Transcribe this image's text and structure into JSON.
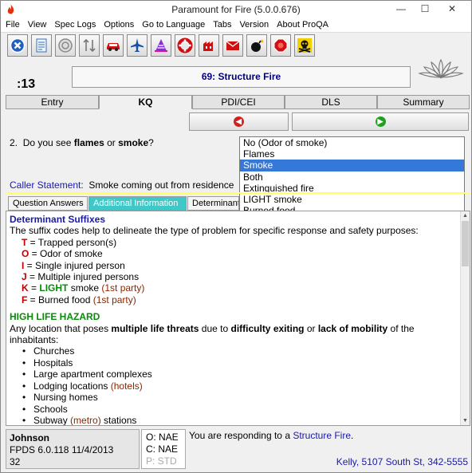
{
  "window": {
    "title": "Paramount for Fire (5.0.0.676)",
    "minimize": "—",
    "maximize": "☐",
    "close": "✕"
  },
  "menu": [
    "File",
    "View",
    "Spec Logs",
    "Options",
    "Go to Language",
    "Tabs",
    "Version",
    "About ProQA"
  ],
  "toolbar": [
    {
      "icon": "close-case-icon",
      "color": "#2060c0"
    },
    {
      "icon": "document-icon",
      "color": "#3a6fb0"
    },
    {
      "icon": "stop-target-icon",
      "color": "#888888"
    },
    {
      "icon": "sort-arrows-icon",
      "color": "#777777"
    },
    {
      "icon": "car-icon",
      "color": "#d01010"
    },
    {
      "icon": "airplane-icon",
      "color": "#1a4fa8"
    },
    {
      "icon": "hazmat-cone-icon",
      "color": "#8a2be2"
    },
    {
      "icon": "lifebuoy-icon",
      "color": "#d01010"
    },
    {
      "icon": "building-icon",
      "color": "#d01010"
    },
    {
      "icon": "envelope-icon",
      "color": "#d01010"
    },
    {
      "icon": "bomb-icon",
      "color": "#111111"
    },
    {
      "icon": "stop-sign-icon",
      "color": "#d01010"
    },
    {
      "icon": "skull-icon",
      "color": "#c8a000"
    }
  ],
  "header": {
    "timer": ":13",
    "protocol": "69:  Structure Fire"
  },
  "main_tabs": [
    "Entry",
    "KQ",
    "PDI/CEI",
    "DLS",
    "Summary"
  ],
  "active_main_tab": "KQ",
  "question": {
    "number": "2.",
    "pre": "Do you see ",
    "b1": "flames",
    "mid": " or ",
    "b2": "smoke",
    "post": "?"
  },
  "answers": [
    "No (Odor of smoke)",
    "Flames",
    "Smoke",
    "Both",
    "Extinguished fire",
    "LIGHT smoke",
    "Burned food"
  ],
  "selected_answer": "Smoke",
  "caller": {
    "label": "Caller Statement:",
    "text": "Smoke coming out from residence"
  },
  "info_tabs": [
    "Question Answers",
    "Additional Information",
    "Determinant"
  ],
  "info": {
    "suffix_title": "Determinant Suffixes",
    "suffix_intro": "The suffix codes help to delineate the type of problem for specific response and safety purposes:",
    "suffixes": [
      {
        "code": "T",
        "text": " = Trapped person(s)"
      },
      {
        "code": "O",
        "text": " = Odor of smoke"
      },
      {
        "code": "I",
        "text": " = Single injured person"
      },
      {
        "code": "J",
        "text": " = Multiple injured persons"
      },
      {
        "code": "K",
        "eq": " = ",
        "light": "LIGHT",
        "text": " smoke ",
        "party": "(1st party)"
      },
      {
        "code": "F",
        "text": " = Burned food ",
        "party": "(1st party)"
      }
    ],
    "hazard_title": "HIGH LIFE HAZARD",
    "hazard_pre": "Any location that poses ",
    "hazard_b1": "multiple life threats",
    "hazard_mid1": " due to ",
    "hazard_b2": "difficulty exiting",
    "hazard_mid2": " or ",
    "hazard_b3": "lack of mobility",
    "hazard_post": " of the inhabitants:",
    "locations": [
      {
        "text": "Churches"
      },
      {
        "text": "Hospitals"
      },
      {
        "text": "Large apartment complexes"
      },
      {
        "text": "Lodging locations ",
        "note": "(hotels)"
      },
      {
        "text": "Nursing homes"
      },
      {
        "text": "Schools"
      },
      {
        "text": "Subway ",
        "note": "(metro)",
        "text2": " stations"
      }
    ]
  },
  "footer": {
    "name": "Johnson",
    "version": "FPDS  6.0.118  11/4/2013",
    "number": "32",
    "codes": [
      "O: NAE",
      "C: NAE",
      "P: STD"
    ],
    "responding_pre": "You are responding to a ",
    "responding_link": "Structure Fire",
    "responding_post": ".",
    "location": "Kelly, 5107 South St, 342-5555"
  }
}
